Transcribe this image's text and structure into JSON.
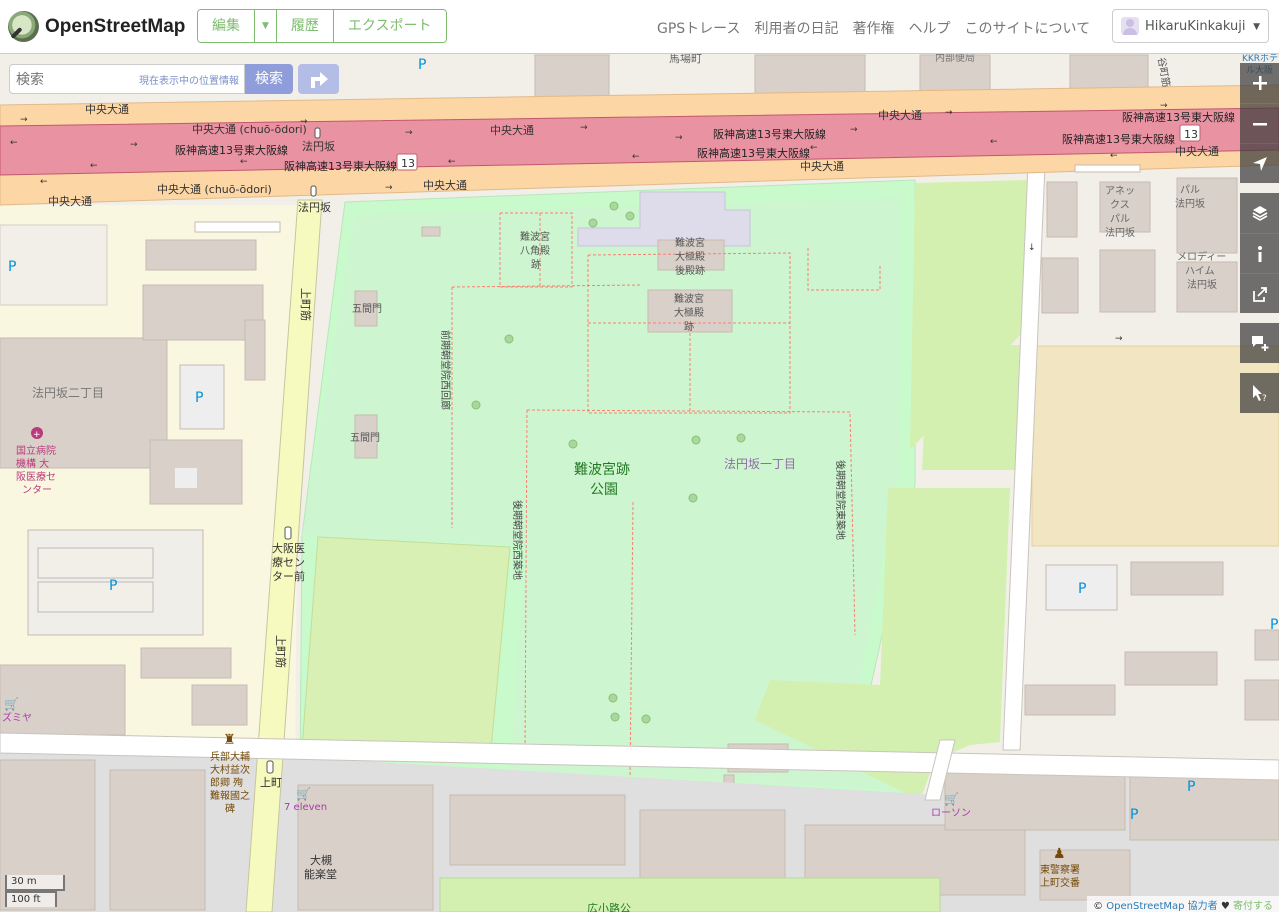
{
  "header": {
    "logo_text": "OpenStreetMap",
    "edit_label": "編集",
    "history_label": "履歴",
    "export_label": "エクスポート",
    "nav": [
      "GPSトレース",
      "利用者の日記",
      "著作権",
      "ヘルプ",
      "このサイトについて"
    ],
    "username": "HikaruKinkakuji"
  },
  "search": {
    "placeholder": "検索",
    "where_am_i": "現在表示中の位置情報",
    "button": "検索"
  },
  "controls": [
    "zoom-in-icon",
    "zoom-out-icon",
    "locate-icon",
    "layers-icon",
    "info-icon",
    "share-icon",
    "add-note-icon",
    "query-icon"
  ],
  "map_labels": {
    "chuo_odori": "中央大通",
    "chuo_odori_roman": "中央大通 (chuō-ōdori)",
    "hanshin": "阪神高速13号東大阪線",
    "route13": "13",
    "hoenzaka": "法円坂",
    "uemachisuji": "上町筋",
    "park_name": "難波宮跡\n公園",
    "hoenzaka_1": "法円坂一丁目",
    "hoenzaka_2": "法円坂二丁目",
    "hakkakuden": "難波宮\n八角殿\n跡",
    "daigokuden_koden": "難波宮\n大極殿\n後殿跡",
    "daigokuden": "難波宮\n大極殿\n跡",
    "gokenmon": "五間門",
    "nishi_kairo": "前期朝堂院西回廊",
    "koki_nishi": "後期朝堂院西築地",
    "koki_higashi": "後期朝堂院東築地",
    "hospital": "国立病院\n機構 大\n阪医療セ\nンター",
    "bus_stop": "大阪医\n療セン\nター前",
    "uemachi": "上町",
    "monument": "兵部大輔\n大村益次\n郎卿 殉\n難報國之\n碑",
    "seven_eleven": "7 eleven",
    "lawson": "ローソン",
    "otsuki": "大槻\n能楽堂",
    "police": "東警察署\n上町交番",
    "annex": "アネッ\nクス\nパル\n法円坂",
    "pal": "パル\n法円坂",
    "melody": "メロディー\nハイム\n法円坂",
    "babacho": "馬場町",
    "parking": "P",
    "izumiya": "ズミヤ",
    "kkr": "KKRホテ\nル大阪",
    "naniwa_bottom": "広小路公",
    "maruyama": "内部便局",
    "tanimachi": "谷町筋"
  },
  "scale": {
    "metric": "30 m",
    "imperial": "100 ft"
  },
  "attribution": {
    "prefix": "©",
    "osm": "OpenStreetMap",
    "contributors": "協力者",
    "heart": "♥",
    "donate": "寄付する"
  },
  "colors": {
    "motorway": "#e892a2",
    "primary": "#fcd6a4",
    "park": "#c8facc",
    "pitch": "#aae0cb",
    "building": "#d9d0c9",
    "residential": "#e0dfdf",
    "accent": "#7ebc6f"
  }
}
